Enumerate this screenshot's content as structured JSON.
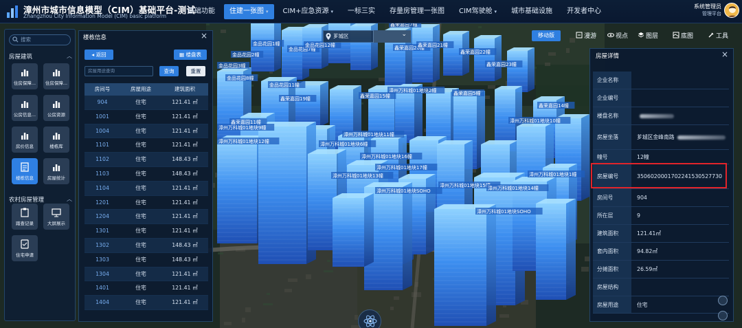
{
  "app": {
    "title": "漳州市城市信息模型（CIM）基础平台-测试",
    "subtitle": "Zhangzhou City Information Model (CIM) basic platform"
  },
  "nav": [
    {
      "label": "基础功能",
      "has_menu": false,
      "active": false
    },
    {
      "label": "住建一张图",
      "has_menu": true,
      "active": true
    },
    {
      "label": "CIM+应急资源",
      "has_menu": true,
      "active": false
    },
    {
      "label": "一标三实",
      "has_menu": false,
      "active": false
    },
    {
      "label": "存量房管理一张图",
      "has_menu": false,
      "active": false
    },
    {
      "label": "CIM驾驶舱",
      "has_menu": true,
      "active": false
    },
    {
      "label": "城市基础设施",
      "has_menu": false,
      "active": false
    },
    {
      "label": "开发者中心",
      "has_menu": false,
      "active": false
    }
  ],
  "user": {
    "name": "系统管理员",
    "sub": "管理平台"
  },
  "left_panel": {
    "search_placeholder": "搜索",
    "section_housing": "房屋建筑",
    "section_rural": "农村房屋管理",
    "tools_housing": [
      {
        "label": "住房保障...",
        "icon": "bar-chart-icon"
      },
      {
        "label": "住房保障...",
        "icon": "bar-chart-icon"
      },
      {
        "label": "公房信息...",
        "icon": "bar-chart-icon"
      },
      {
        "label": "公房资源",
        "icon": "bar-chart-icon"
      },
      {
        "label": "房价信息",
        "icon": "bar-chart-icon"
      },
      {
        "label": "楼栋库",
        "icon": "bar-chart-icon"
      },
      {
        "label": "楼栋信息",
        "icon": "building-doc-icon"
      },
      {
        "label": "房屋统计",
        "icon": "bar-chart-icon"
      }
    ],
    "tools_rural": [
      {
        "label": "踏查记录",
        "icon": "clipboard-icon"
      },
      {
        "label": "大屏展示",
        "icon": "monitor-icon"
      },
      {
        "label": "住宅申请",
        "icon": "apply-icon"
      }
    ]
  },
  "building_panel": {
    "title": "楼栋信息",
    "back_label": "◂ 返回",
    "floor_table_label": "楼盘表",
    "input_placeholder": "房屋用途查询",
    "search_label": "查询",
    "reset_label": "重置",
    "columns": [
      "房间号",
      "房屋用途",
      "建筑面积"
    ],
    "rows": [
      [
        "904",
        "住宅",
        "121.41 ㎡"
      ],
      [
        "1001",
        "住宅",
        "121.41 ㎡"
      ],
      [
        "1004",
        "住宅",
        "121.41 ㎡"
      ],
      [
        "1101",
        "住宅",
        "121.41 ㎡"
      ],
      [
        "1102",
        "住宅",
        "148.43 ㎡"
      ],
      [
        "1103",
        "住宅",
        "148.43 ㎡"
      ],
      [
        "1104",
        "住宅",
        "121.41 ㎡"
      ],
      [
        "1201",
        "住宅",
        "121.41 ㎡"
      ],
      [
        "1204",
        "住宅",
        "121.41 ㎡"
      ],
      [
        "1301",
        "住宅",
        "121.41 ㎡"
      ],
      [
        "1302",
        "住宅",
        "148.43 ㎡"
      ],
      [
        "1303",
        "住宅",
        "148.43 ㎡"
      ],
      [
        "1304",
        "住宅",
        "121.41 ㎡"
      ],
      [
        "1401",
        "住宅",
        "121.41 ㎡"
      ],
      [
        "1404",
        "住宅",
        "121.41 ㎡"
      ]
    ]
  },
  "map_toolbar": {
    "district_label": "芗城区",
    "mobile_label": "移动版",
    "items": [
      {
        "label": "漫游",
        "icon": "roam-icon"
      },
      {
        "label": "视点",
        "icon": "eye-icon"
      },
      {
        "label": "图层",
        "icon": "layers-icon"
      },
      {
        "label": "底图",
        "icon": "basemap-icon"
      },
      {
        "label": "工具",
        "icon": "tools-icon"
      }
    ]
  },
  "map_labels": [
    "鑫荣嘉园7幢",
    "金品花园1幢",
    "金品花园7幢",
    "金品花园3幢",
    "金品花园2幢",
    "金品花园12幢",
    "鑫荣嘉园20幢",
    "鑫荣嘉园21幢",
    "鑫荣嘉园22幢",
    "鑫荣嘉园23幢",
    "金品花园8幢",
    "金品花园11幢",
    "鑫荣嘉园19幢",
    "漳州万科城01地块2幢",
    "鑫荣嘉园5幢",
    "鑫荣嘉园15幢",
    "鑫荣嘉园14幢",
    "漳州万科城01地块10幢",
    "漳州万科城01地块9幢",
    "鑫荣嘉园11幢",
    "漳州万科城01地块11幢",
    "漳州万科城01地块12幢",
    "漳州万科城01地块6幢",
    "漳州万科城01地块16幢",
    "漳州万科城01地块13幢",
    "漳州万科城01地块17幢",
    "漳州万科城01地块15幢",
    "漳州万科城01地块14幢",
    "漳州万科城01地块1幢",
    "漳州万科城01地块SOHO",
    "漳州万科城01地块SOHO"
  ],
  "detail_panel": {
    "title": "房屋详情",
    "fields": [
      {
        "key": "企业名称",
        "value": ""
      },
      {
        "key": "企业编号",
        "value": ""
      },
      {
        "key": "楼盘名称",
        "value": ""
      },
      {
        "key": "房屋坐落",
        "value": "芗城区金峰南路"
      },
      {
        "key": "幢号",
        "value": "12幢"
      },
      {
        "key": "房屋编号",
        "value": "3506020001702241530527730"
      },
      {
        "key": "房间号",
        "value": "904"
      },
      {
        "key": "所在层",
        "value": "9"
      },
      {
        "key": "建筑面积",
        "value": "121.41㎡"
      },
      {
        "key": "套内面积",
        "value": "94.82㎡"
      },
      {
        "key": "分摊面积",
        "value": "26.59㎡"
      },
      {
        "key": "房屋结构",
        "value": ""
      },
      {
        "key": "房屋用途",
        "value": "住宅"
      }
    ]
  },
  "colors": {
    "accent": "#2f7fe0",
    "highlight": "#e2242a",
    "building": "#3d8ff0",
    "panel_bg": "#0c1b30"
  }
}
